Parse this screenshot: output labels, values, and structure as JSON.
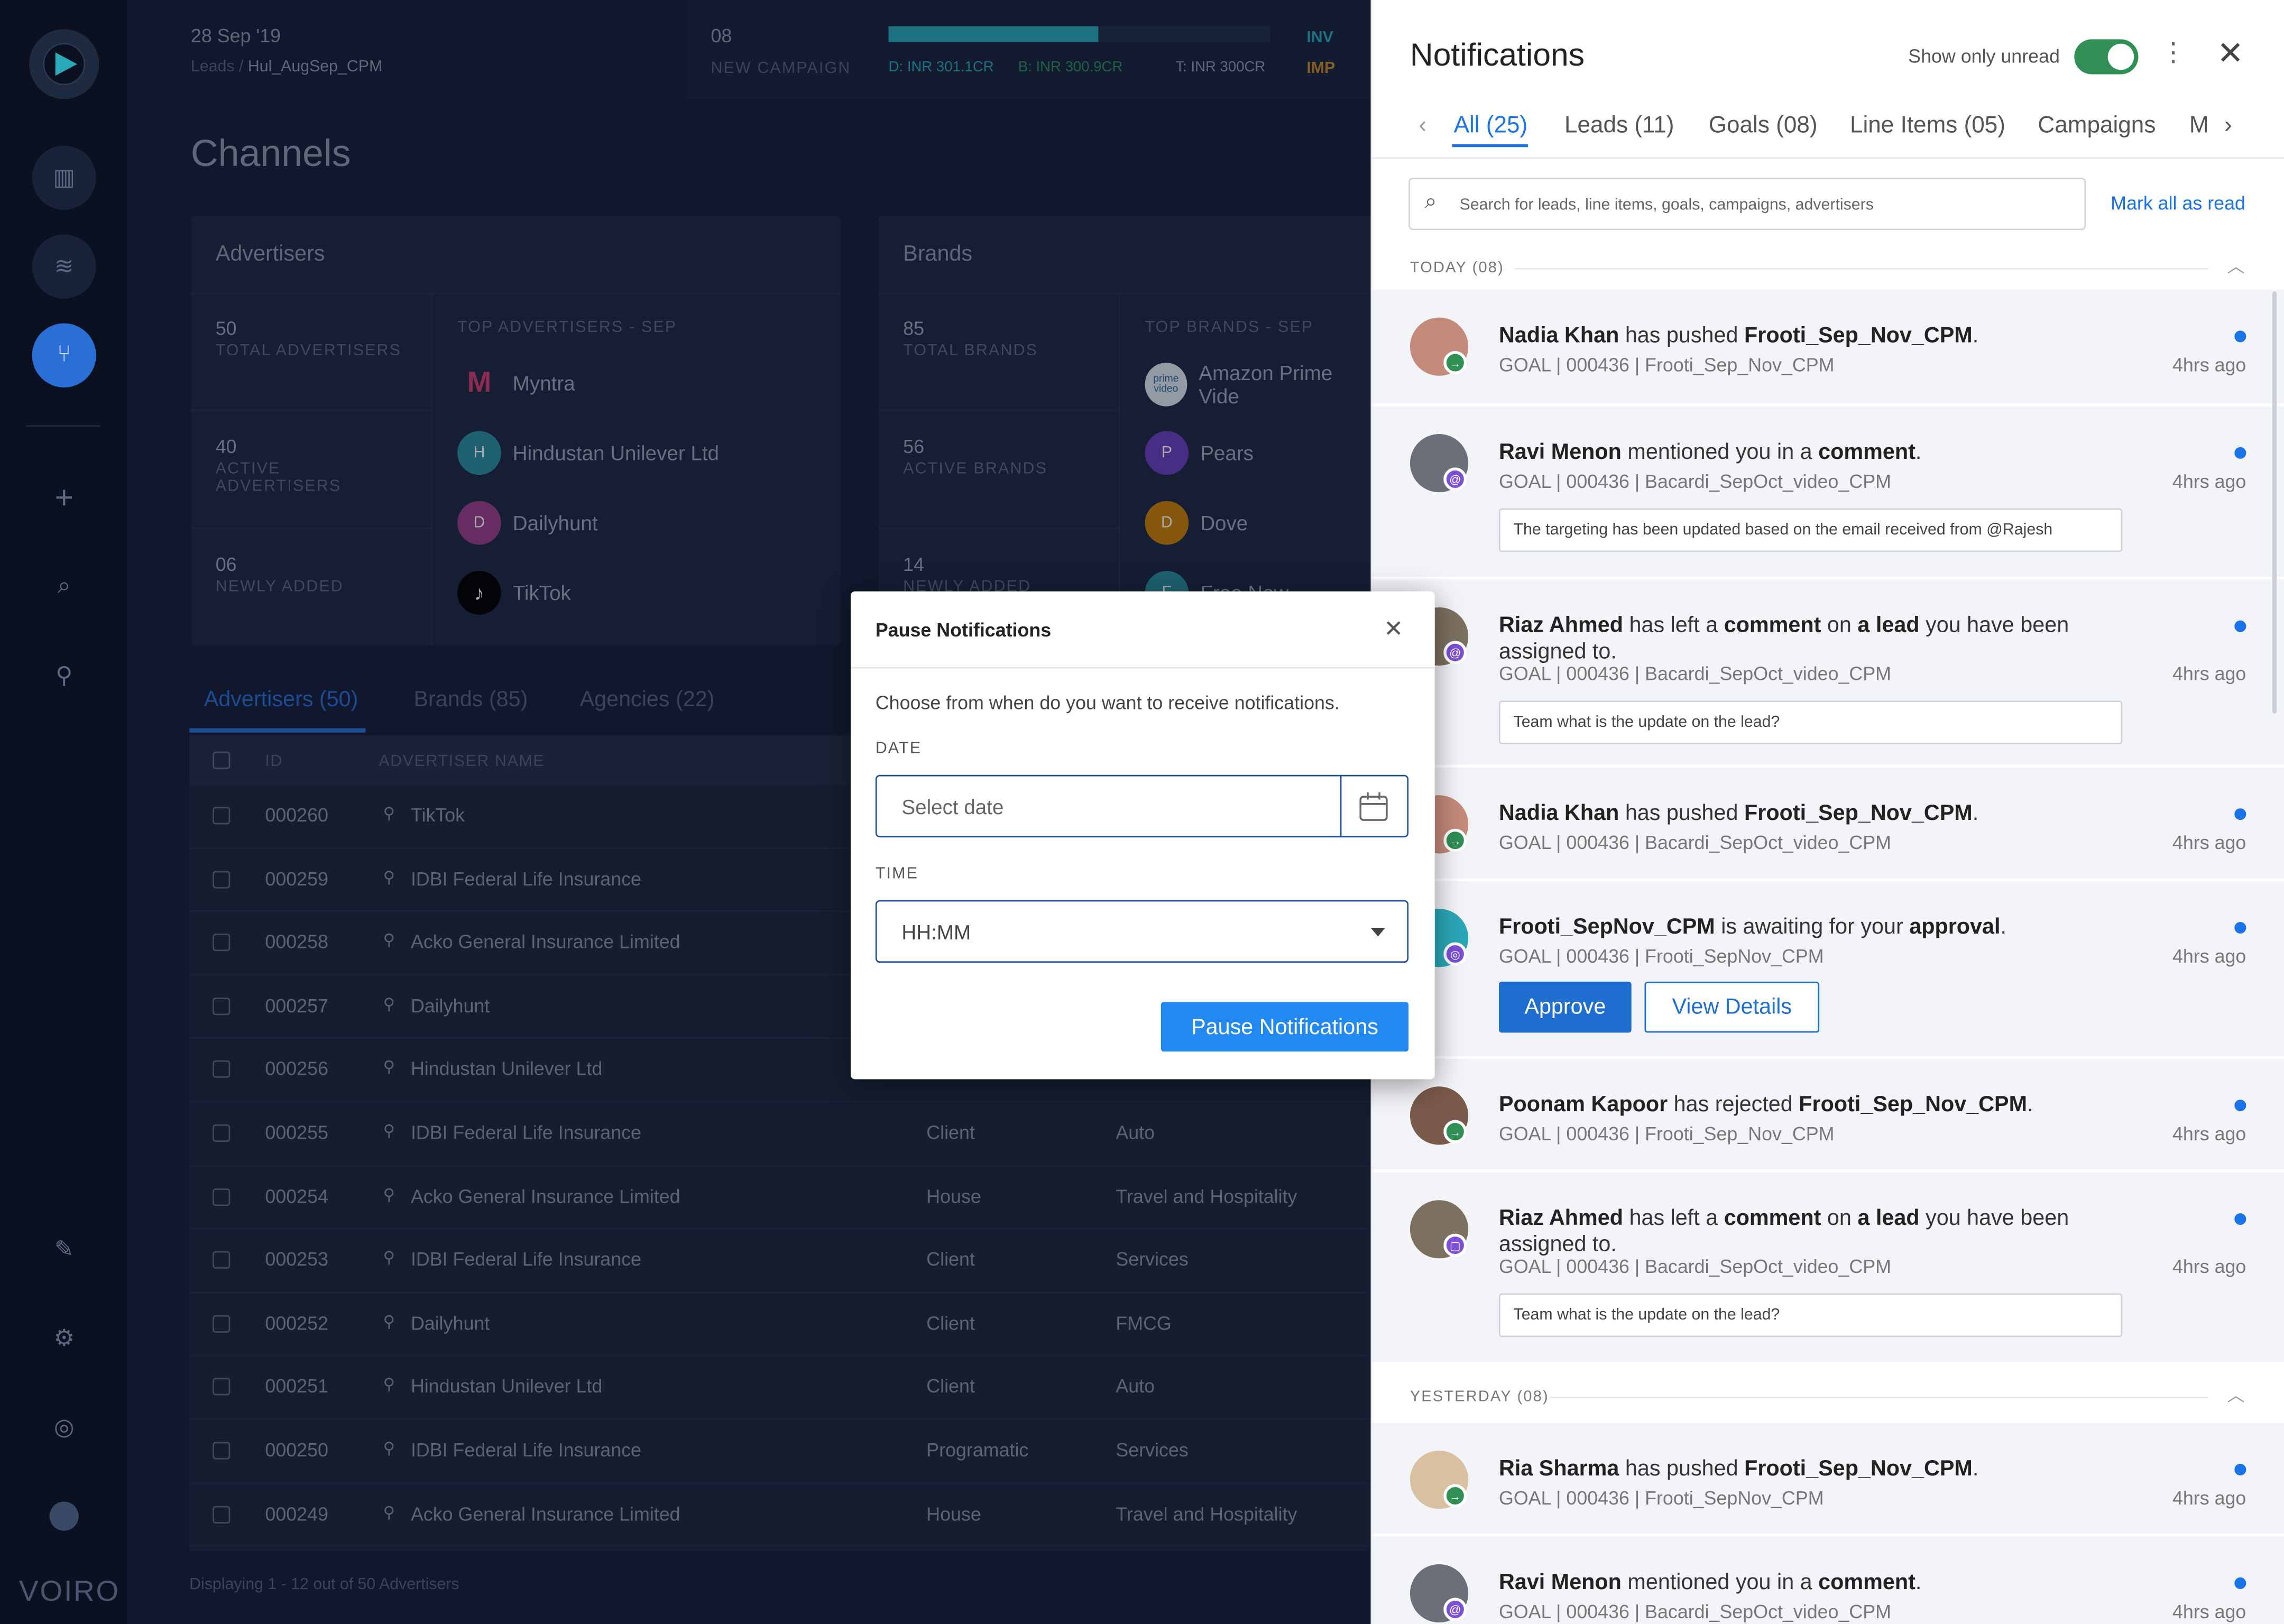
{
  "brand": "VOIRO",
  "header": {
    "date": "28 Sep '19",
    "breadcrumb_root": "Leads",
    "breadcrumb_sep": "/",
    "breadcrumb_current": "Hul_AugSep_CPM",
    "campaign_count": "08",
    "campaign_label": "NEW CAMPAIGN",
    "delivered": "D: INR 301.1CR",
    "booked": "B: INR 300.9CR",
    "target": "T: INR 300CR",
    "inv_label": "INV",
    "imp_label": "IMP"
  },
  "page_title": "Channels",
  "advertisers_card": {
    "title": "Advertisers",
    "stats": [
      {
        "value": "50",
        "label": "TOTAL ADVERTISERS"
      },
      {
        "value": "40",
        "label": "ACTIVE ADVERTISERS"
      },
      {
        "value": "06",
        "label": "NEWLY ADDED"
      }
    ],
    "top_label": "TOP ADVERTISERS - SEP",
    "top": [
      {
        "initial": "",
        "name": "Myntra"
      },
      {
        "initial": "H",
        "name": "Hindustan Unilever Ltd"
      },
      {
        "initial": "D",
        "name": "Dailyhunt"
      },
      {
        "initial": "",
        "name": "TikTok"
      }
    ]
  },
  "brands_card": {
    "title": "Brands",
    "stats": [
      {
        "value": "85",
        "label": "TOTAL BRANDS"
      },
      {
        "value": "56",
        "label": "ACTIVE BRANDS"
      },
      {
        "value": "14",
        "label": "NEWLY ADDED"
      }
    ],
    "top_label": "TOP BRANDS - SEP",
    "top": [
      {
        "initial": "prime video",
        "name": "Amazon Prime Vide"
      },
      {
        "initial": "P",
        "name": "Pears"
      },
      {
        "initial": "D",
        "name": "Dove"
      },
      {
        "initial": "F",
        "name": "Free Now"
      }
    ]
  },
  "tabs": [
    "Advertisers (50)",
    "Brands (85)",
    "Agencies (22)"
  ],
  "table": {
    "headers": [
      "ID",
      "ADVERTISER NAME"
    ],
    "rows": [
      {
        "id": "000260",
        "name": "TikTok",
        "type": "",
        "category": ""
      },
      {
        "id": "000259",
        "name": "IDBI Federal Life Insurance",
        "type": "",
        "category": ""
      },
      {
        "id": "000258",
        "name": "Acko General Insurance Limited",
        "type": "",
        "category": ""
      },
      {
        "id": "000257",
        "name": "Dailyhunt",
        "type": "",
        "category": ""
      },
      {
        "id": "000256",
        "name": "Hindustan Unilever Ltd",
        "type": "",
        "category": ""
      },
      {
        "id": "000255",
        "name": "IDBI Federal Life Insurance",
        "type": "Client",
        "category": "Auto"
      },
      {
        "id": "000254",
        "name": "Acko General Insurance Limited",
        "type": "House",
        "category": "Travel and Hospitality"
      },
      {
        "id": "000253",
        "name": "IDBI Federal Life Insurance",
        "type": "Client",
        "category": "Services"
      },
      {
        "id": "000252",
        "name": "Dailyhunt",
        "type": "Client",
        "category": "FMCG"
      },
      {
        "id": "000251",
        "name": "Hindustan Unilever Ltd",
        "type": "Client",
        "category": "Auto"
      },
      {
        "id": "000250",
        "name": "IDBI Federal Life Insurance",
        "type": "Programatic",
        "category": "Services"
      },
      {
        "id": "000249",
        "name": "Acko General Insurance Limited",
        "type": "House",
        "category": "Travel and Hospitality"
      }
    ],
    "footer": "Displaying 1 - 12 out of 50 Advertisers"
  },
  "notifications": {
    "title": "Notifications",
    "show_unread_label": "Show only unread",
    "tabs": [
      "All (25)",
      "Leads (11)",
      "Goals (08)",
      "Line Items (05)",
      "Campaigns",
      "M"
    ],
    "search_placeholder": "Search for leads, line items, goals, campaigns, advertisers",
    "mark_all": "Mark all as read",
    "today_label": "TODAY (08)",
    "yesterday_label": "YESTERDAY (08)",
    "approve_label": "Approve",
    "view_details_label": "View Details",
    "items": [
      {
        "actor": "Nadia Khan",
        "pre": " has pushed ",
        "mid": "Frooti_Sep_Nov_CPM",
        "post": ".",
        "sub": "GOAL | 000436 | Frooti_Sep_Nov_CPM",
        "ago": "4hrs ago"
      },
      {
        "actor": "Ravi Menon",
        "pre": " mentioned you in a ",
        "mid": "comment",
        "post": ".",
        "sub": "GOAL | 000436 | Bacardi_SepOct_video_CPM",
        "ago": "4hrs ago",
        "comment": "The targeting has been updated based on the email received from @Rajesh"
      },
      {
        "actor": "Riaz Ahmed",
        "pre": " has left a ",
        "mid": "comment",
        "mid2": " on ",
        "mid3": "a lead",
        "post": " you have been assigned to.",
        "sub": "GOAL | 000436 | Bacardi_SepOct_video_CPM",
        "ago": "4hrs ago",
        "comment": "Team what is the update on the lead?"
      },
      {
        "actor": "Nadia Khan",
        "pre": " has pushed ",
        "mid": "Frooti_Sep_Nov_CPM",
        "post": ".",
        "sub": "GOAL | 000436 | Bacardi_SepOct_video_CPM",
        "ago": "4hrs ago"
      },
      {
        "actor": "Frooti_SepNov_CPM",
        "pre": " is awaiting for your ",
        "mid": "approval",
        "post": ".",
        "sub": "GOAL | 000436 | Frooti_SepNov_CPM",
        "ago": "4hrs ago"
      },
      {
        "actor": "Poonam Kapoor",
        "pre": " has rejected ",
        "mid": "Frooti_Sep_Nov_CPM",
        "post": ".",
        "sub": "GOAL | 000436 | Frooti_Sep_Nov_CPM",
        "ago": "4hrs ago"
      },
      {
        "actor": "Riaz Ahmed",
        "pre": " has left a ",
        "mid": "comment",
        "mid2": " on ",
        "mid3": "a lead",
        "post": " you have been assigned to.",
        "sub": "GOAL | 000436 | Bacardi_SepOct_video_CPM",
        "ago": "4hrs ago",
        "comment": "Team what is the update on the lead?"
      },
      {
        "actor": "Ria Sharma",
        "pre": " has pushed ",
        "mid": "Frooti_Sep_Nov_CPM",
        "post": ".",
        "sub": "GOAL | 000436 | Frooti_SepNov_CPM",
        "ago": "4hrs ago"
      },
      {
        "actor": "Ravi Menon",
        "pre": " mentioned you in a ",
        "mid": "comment",
        "post": ".",
        "sub": "GOAL | 000436 | Bacardi_SepOct_video_CPM",
        "ago": "4hrs ago"
      }
    ]
  },
  "modal": {
    "title": "Pause Notifications",
    "description": "Choose from when do you want to receive notifications.",
    "date_label": "DATE",
    "date_placeholder": "Select date",
    "time_label": "TIME",
    "time_value": "HH:MM",
    "submit": "Pause Notifications"
  },
  "colors": {
    "accent": "#1a73e8",
    "toggle_on": "#2f8f55",
    "button": "#2389f2"
  }
}
